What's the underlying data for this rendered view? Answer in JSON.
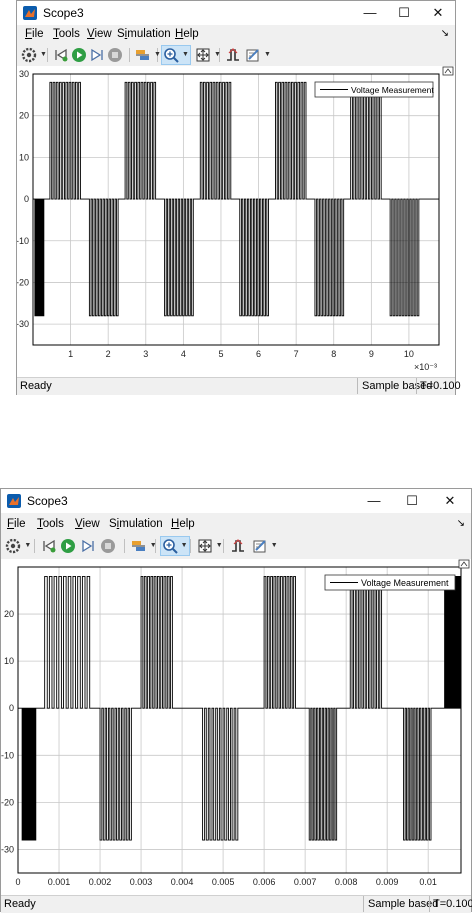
{
  "windows": [
    {
      "title": "Scope3",
      "menu": [
        "File",
        "Tools",
        "View",
        "Simulation",
        "Help"
      ],
      "menu_mnemonics": [
        "F",
        "T",
        "V",
        "i",
        "H"
      ],
      "window_controls": {
        "minimize": "—",
        "maximize": "☐",
        "close": "✕"
      },
      "toolbar_icons": [
        "settings-icon",
        "step-back-icon",
        "run-icon",
        "step-forward-icon",
        "stop-icon",
        "highlight-icon",
        "zoom-in-icon",
        "scale-axes-icon",
        "triggers-icon",
        "measurements-icon"
      ],
      "status": {
        "ready": "Ready",
        "mode": "Sample based",
        "time": "T=0.100"
      },
      "legend": "Voltage Measurement",
      "chart_data": {
        "type": "line",
        "series": [
          {
            "name": "Voltage Measurement",
            "levels": [
              -28,
              0,
              28
            ],
            "pwm_groups": [
              {
                "sign": -1,
                "start": 0.05,
                "end": 0.3
              },
              {
                "sign": 1,
                "start": 0.45,
                "end": 1.3
              },
              {
                "sign": -1,
                "start": 1.5,
                "end": 2.3
              },
              {
                "sign": 1,
                "start": 2.45,
                "end": 3.3
              },
              {
                "sign": -1,
                "start": 3.5,
                "end": 4.3
              },
              {
                "sign": 1,
                "start": 4.45,
                "end": 5.3
              },
              {
                "sign": -1,
                "start": 5.5,
                "end": 6.3
              },
              {
                "sign": 1,
                "start": 6.45,
                "end": 7.3
              },
              {
                "sign": -1,
                "start": 7.5,
                "end": 8.3
              },
              {
                "sign": 1,
                "start": 8.45,
                "end": 9.3
              },
              {
                "sign": -1,
                "start": 9.5,
                "end": 10.3
              }
            ]
          }
        ],
        "xlim": [
          0,
          10.8
        ],
        "ylim": [
          -35,
          30
        ],
        "xticks": [
          "1",
          "2",
          "3",
          "4",
          "5",
          "6",
          "7",
          "8",
          "9",
          "10"
        ],
        "xtick_values": [
          1,
          2,
          3,
          4,
          5,
          6,
          7,
          8,
          9,
          10
        ],
        "yticks": [
          "30",
          "20",
          "10",
          "0",
          "-10",
          "-20",
          "-30"
        ],
        "ytick_values": [
          30,
          20,
          10,
          0,
          -10,
          -20,
          -30
        ],
        "x_exponent": "×10⁻³",
        "grid": true,
        "legend_position": "top-right"
      }
    },
    {
      "title": "Scope3",
      "menu": [
        "File",
        "Tools",
        "View",
        "Simulation",
        "Help"
      ],
      "menu_mnemonics": [
        "F",
        "T",
        "V",
        "i",
        "H"
      ],
      "window_controls": {
        "minimize": "—",
        "maximize": "☐",
        "close": "✕"
      },
      "toolbar_icons": [
        "settings-icon",
        "step-back-icon",
        "run-icon",
        "step-forward-icon",
        "stop-icon",
        "highlight-icon",
        "zoom-in-icon",
        "scale-axes-icon",
        "triggers-icon",
        "measurements-icon"
      ],
      "status": {
        "ready": "Ready",
        "mode": "Sample based",
        "time": "T=0.100"
      },
      "legend": "Voltage Measurement",
      "chart_data": {
        "type": "line",
        "series": [
          {
            "name": "Voltage Measurement",
            "levels": [
              -28,
              0,
              28
            ],
            "pwm_groups": [
              {
                "sign": -1,
                "start": 0.0001,
                "end": 0.00045
              },
              {
                "sign": 1,
                "start": 0.00065,
                "end": 0.0018
              },
              {
                "sign": -1,
                "start": 0.002,
                "end": 0.0028
              },
              {
                "sign": 1,
                "start": 0.003,
                "end": 0.0038
              },
              {
                "sign": -1,
                "start": 0.0045,
                "end": 0.0054
              },
              {
                "sign": 1,
                "start": 0.006,
                "end": 0.0068
              },
              {
                "sign": -1,
                "start": 0.0071,
                "end": 0.0078
              },
              {
                "sign": 1,
                "start": 0.0081,
                "end": 0.0089
              },
              {
                "sign": -1,
                "start": 0.0094,
                "end": 0.0101
              },
              {
                "sign": 1,
                "start": 0.0104,
                "end": 0.0108
              }
            ]
          }
        ],
        "xlim": [
          0,
          0.0108
        ],
        "ylim": [
          -35,
          30
        ],
        "xticks": [
          "0",
          "0.001",
          "0.002",
          "0.003",
          "0.004",
          "0.005",
          "0.006",
          "0.007",
          "0.008",
          "0.009",
          "0.01"
        ],
        "xtick_values": [
          0,
          0.001,
          0.002,
          0.003,
          0.004,
          0.005,
          0.006,
          0.007,
          0.008,
          0.009,
          0.01
        ],
        "yticks": [
          "20",
          "10",
          "0",
          "-10",
          "-20",
          "-30"
        ],
        "ytick_values": [
          20,
          10,
          0,
          -10,
          -20,
          -30
        ],
        "x_exponent": "",
        "grid": true,
        "legend_position": "top-right"
      }
    }
  ],
  "colors": {
    "grid": "#c8c8c8",
    "trace": "#000000",
    "axes_bg": "#ffffff",
    "window_bg": "#f0f0f0",
    "selected_tool": "#cce4f7"
  }
}
